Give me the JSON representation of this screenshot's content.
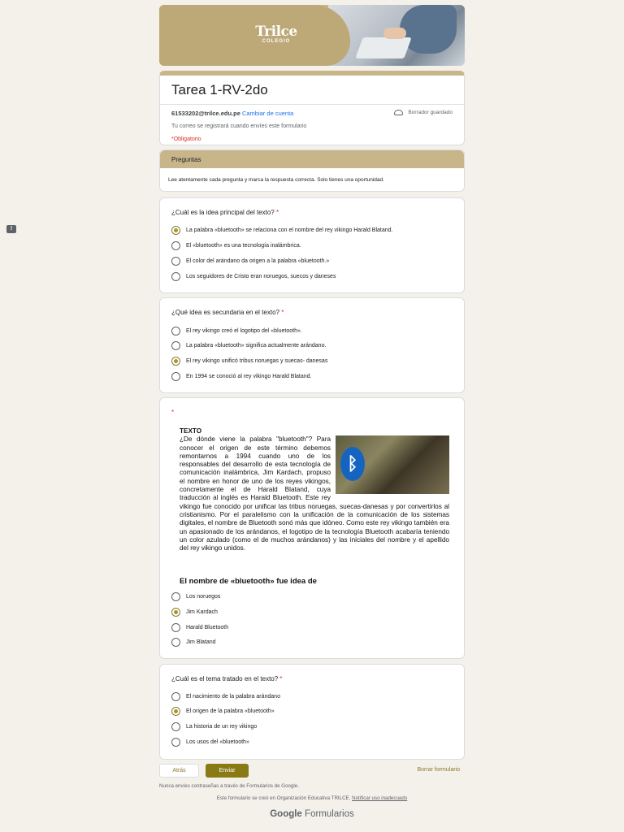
{
  "header": {
    "logo_name": "Trilce",
    "logo_sub": "COLEGIO"
  },
  "form": {
    "title": "Tarea 1-RV-2do",
    "email": "61533202@trilce.edu.pe",
    "switch_account": "Cambiar de cuenta",
    "saved_status": "Borrador guardado",
    "email_note": "Tu correo se registrará cuando envíes este formulario",
    "required_note": "*Obligatorio"
  },
  "section": {
    "title": "Preguntas",
    "description": "Lee atentamente cada pregunta y marca la respuesta correcta. Solo tienes una oportunidad."
  },
  "questions": [
    {
      "title": "¿Cuál es la idea principal del texto?",
      "required": "*",
      "options": [
        "La palabra «bluetooth» se relaciona con el nombre del rey vikingo Harald Blatand.",
        "El «bluetooth» es una tecnología inalámbrica.",
        "El color del arándano da origen a la palabra «bluetooth.»",
        "Los seguidores de Cristo eran noruegos, suecos y daneses"
      ],
      "selected": 0
    },
    {
      "title": "¿Qué idea es secundaria en el texto?",
      "required": "*",
      "options": [
        "El rey vikingo creó el logotipo del «bluetooth».",
        "La palabra «bluetooth» significa actualmente arándano.",
        "El rey vikingo unificó tribus noruegas y suecas- danesas",
        "En 1994 se conoció al rey vikingo Harald Blatand."
      ],
      "selected": 2
    },
    {
      "title": "",
      "required": "*",
      "text_heading": "TEXTO",
      "text_body_1": "¿De dónde viene la palabra \"bluetooth\"? Para conocer el origen de este término debemos remontarnos a 1994 cuando uno de los responsables del desarrollo de esta tecnología de comunicación inalámbrica, Jim Kardach, propuso el nombre en honor de uno de los reyes vikingos, concretamente el de Harald Blatand, cuya traducción al inglés es Harald Bluetooth.",
      "text_body_2": "Este rey vikingo fue conocido por unificar las tribus noruegas, suecas-danesas y por convertirlos al cristianismo. Por el paralelismo con la unificación de la comunicación de los sistemas digitales, el nombre de Bluetooth sonó más que idóneo. Como este rey vikingo también era un apasionado de los arándanos, el logotipo de la tecnología Bluetooth acabaría teniendo un color azulado (como el de muchos arándanos) y las iniciales del nombre y el apellido del rey vikingo unidos.",
      "prompt": "El nombre de «bluetooth» fue idea de",
      "options": [
        "Los noruegos",
        "Jim Kardach",
        "Harald Bluetooth",
        "Jim Blatand"
      ],
      "selected": 1
    },
    {
      "title": "¿Cuál es el tema tratado en el texto?",
      "required": "*",
      "options": [
        "El nacimiento de la palabra arándano",
        "El origen de la palabra «bluetooth»",
        "La historia de un rey vikingo",
        "Los usos del «bluetooth»"
      ],
      "selected": 1
    }
  ],
  "actions": {
    "back": "Atrás",
    "send": "Enviar",
    "clear": "Borrar formulario"
  },
  "footer": {
    "password_note": "Nunca envíes contraseñas a través de Formularios de Google.",
    "created_note": "Este formulario se creó en Organización Educativa TRILCE.",
    "report_link": "Notificar uso inadecuado",
    "brand_google": "Google",
    "brand_forms": "Formularios"
  },
  "colors": {
    "accent": "#c8b68a",
    "button": "#8a7a16",
    "required": "#d93025",
    "link": "#1a73e8"
  }
}
